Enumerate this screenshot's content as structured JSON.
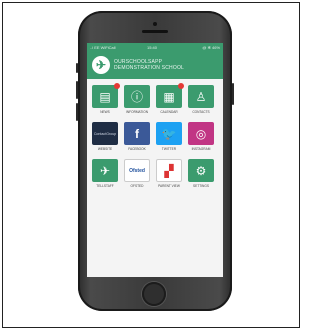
{
  "status_bar": {
    "left": "..l EE WiFiCall",
    "time": "15:40",
    "right": "@ ✻ 46%"
  },
  "header": {
    "line1": "OURSCHOOLSAPP",
    "line2": "DEMONSTRATION SCHOOL",
    "logo_glyph": "✈"
  },
  "tiles": [
    {
      "label": "NEWS",
      "glyph": "▤",
      "badge": "",
      "color": "#3b9b6e"
    },
    {
      "label": "INFORMATION",
      "glyph": "ⓘ",
      "badge": "",
      "color": "#3b9b6e"
    },
    {
      "label": "CALENDAR",
      "glyph": "▦",
      "badge": "",
      "color": "#3b9b6e"
    },
    {
      "label": "CONTACTS",
      "glyph": "♙",
      "badge": "",
      "color": "#3b9b6e"
    },
    {
      "label": "WEBSITE",
      "glyph": "ContactGroup",
      "badge": "",
      "color": "#1f2d44"
    },
    {
      "label": "FACEBOOK",
      "glyph": "f",
      "badge": "",
      "color": "#3b5998"
    },
    {
      "label": "TWITTER",
      "glyph": "🐦",
      "badge": "",
      "color": "#1da1f2"
    },
    {
      "label": "INSTAGRAM",
      "glyph": "◎",
      "badge": "",
      "color": "#c13584"
    },
    {
      "label": "TELLSTAFF",
      "glyph": "✈",
      "badge": "",
      "color": "#3b9b6e"
    },
    {
      "label": "OFSTED",
      "glyph": "Ofsted",
      "badge": "",
      "color": "#ffffff"
    },
    {
      "label": "PARENT VIEW",
      "glyph": "▞",
      "badge": "",
      "color": "#ffffff"
    },
    {
      "label": "SETTINGS",
      "glyph": "⚙",
      "badge": "",
      "color": "#3b9b6e"
    }
  ]
}
